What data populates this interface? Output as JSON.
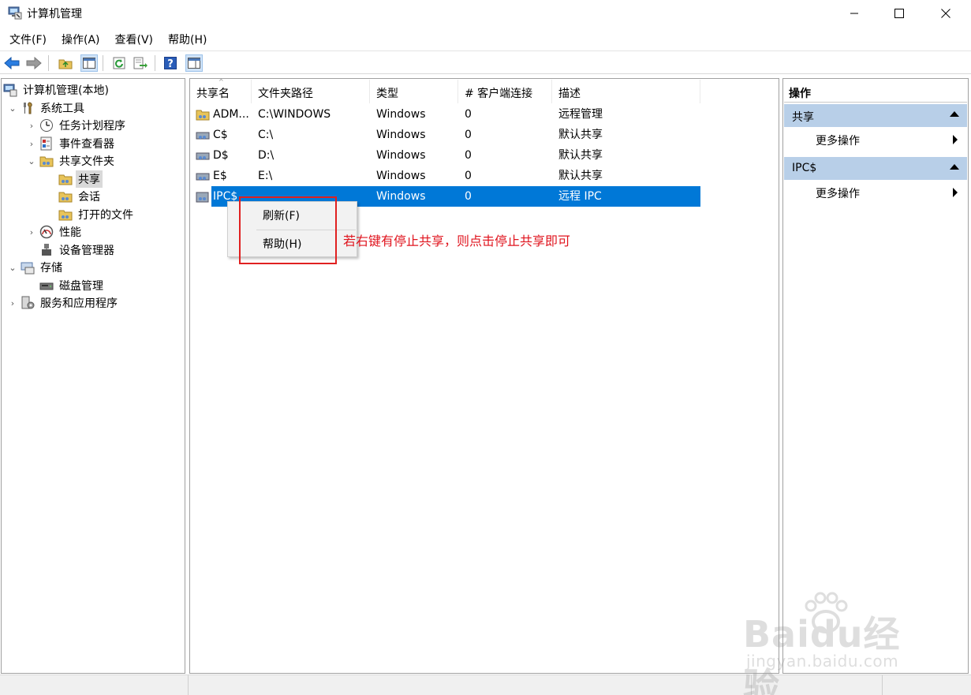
{
  "window": {
    "title": "计算机管理"
  },
  "menu": [
    "文件(F)",
    "操作(A)",
    "查看(V)",
    "帮助(H)"
  ],
  "tree": {
    "root": "计算机管理(本地)",
    "system_tools": "系统工具",
    "task_scheduler": "任务计划程序",
    "event_viewer": "事件查看器",
    "shared_folders": "共享文件夹",
    "shares": "共享",
    "sessions": "会话",
    "open_files": "打开的文件",
    "performance": "性能",
    "device_manager": "设备管理器",
    "storage": "存储",
    "disk_management": "磁盘管理",
    "services_apps": "服务和应用程序"
  },
  "list": {
    "columns": [
      "共享名",
      "文件夹路径",
      "类型",
      "# 客户端连接",
      "描述"
    ],
    "rows": [
      {
        "name": "ADM...",
        "path": "C:\\WINDOWS",
        "type": "Windows",
        "clients": "0",
        "desc": "远程管理"
      },
      {
        "name": "C$",
        "path": "C:\\",
        "type": "Windows",
        "clients": "0",
        "desc": "默认共享"
      },
      {
        "name": "D$",
        "path": "D:\\",
        "type": "Windows",
        "clients": "0",
        "desc": "默认共享"
      },
      {
        "name": "E$",
        "path": "E:\\",
        "type": "Windows",
        "clients": "0",
        "desc": "默认共享"
      },
      {
        "name": "IPC$",
        "path": "",
        "type": "Windows",
        "clients": "0",
        "desc": "远程 IPC"
      }
    ]
  },
  "context_menu": {
    "refresh": "刷新(F)",
    "help": "帮助(H)"
  },
  "annotation": "若右键有停止共享，则点击停止共享即可",
  "actions": {
    "header": "操作",
    "group1": "共享",
    "group1_item": "更多操作",
    "group2": "IPC$",
    "group2_item": "更多操作"
  },
  "watermark": {
    "main": "Baidu经验",
    "sub": "jingyan.baidu.com"
  },
  "colors": {
    "selection": "#0078d7",
    "annotation": "#e0141e",
    "group_header": "#b8cfe8"
  }
}
